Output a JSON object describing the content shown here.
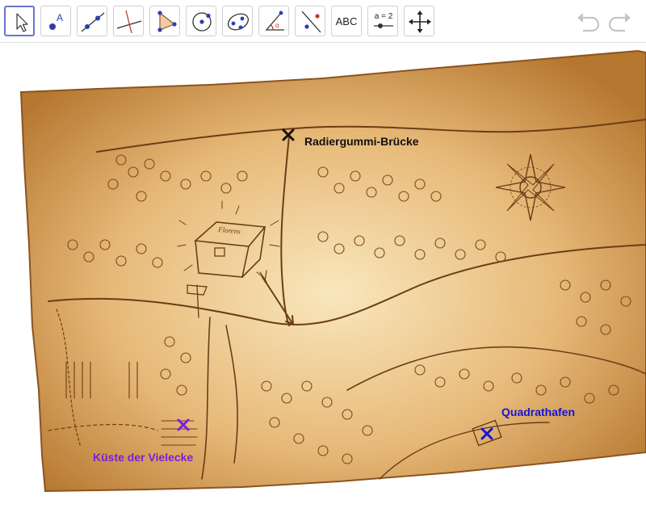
{
  "toolbar": {
    "tools": [
      {
        "name": "Move",
        "icon": "cursor-arrow-icon",
        "active": true
      },
      {
        "name": "Point",
        "icon": "point-icon",
        "active": false
      },
      {
        "name": "Line",
        "icon": "line-through-points-icon",
        "active": false
      },
      {
        "name": "Perpendicular Line",
        "icon": "perpendicular-line-icon",
        "active": false
      },
      {
        "name": "Polygon",
        "icon": "polygon-icon",
        "active": false
      },
      {
        "name": "Circle with Center",
        "icon": "circle-center-icon",
        "active": false
      },
      {
        "name": "Ellipse",
        "icon": "ellipse-icon",
        "active": false
      },
      {
        "name": "Angle",
        "icon": "angle-icon",
        "active": false
      },
      {
        "name": "Reflect about Line",
        "icon": "reflect-line-icon",
        "active": false
      },
      {
        "name": "Text",
        "icon": "text-icon",
        "label": "ABC",
        "active": false
      },
      {
        "name": "Slider",
        "icon": "slider-icon",
        "label": "a = 2",
        "active": false
      },
      {
        "name": "Move Graphics View",
        "icon": "move-view-icon",
        "active": false
      }
    ],
    "undo_icon": "undo-icon",
    "redo_icon": "redo-icon"
  },
  "map": {
    "chest_label": "Florens",
    "points": [
      {
        "label": "Radiergummi-Brücke",
        "color": "#111111"
      },
      {
        "label": "Küste der Vielecke",
        "color": "#7a1fd8"
      },
      {
        "label": "Quadrathafen",
        "color": "#1414d8"
      }
    ]
  },
  "colors": {
    "accent": "#6a73c9",
    "parchment": "#e5b97a",
    "ink": "#6b3d16"
  }
}
